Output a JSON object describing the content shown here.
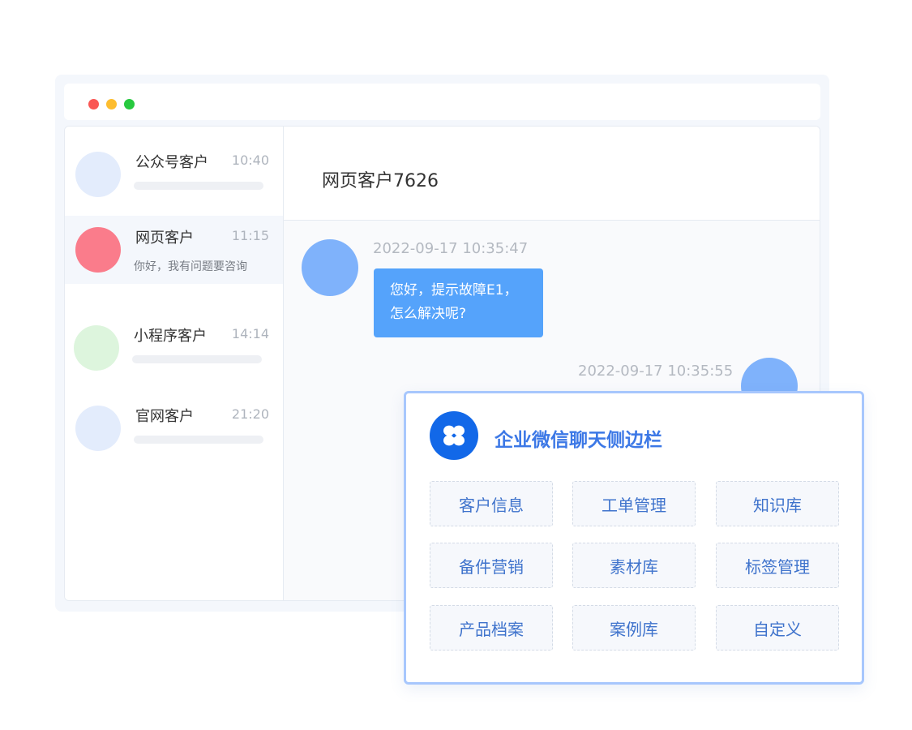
{
  "window_controls": [
    "close",
    "minimize",
    "maximize"
  ],
  "conversations": [
    {
      "name": "公众号客户",
      "time": "10:40",
      "preview": "",
      "avatar_color": "#e3ecfc",
      "active": false
    },
    {
      "name": "网页客户",
      "time": "11:15",
      "preview": "你好，我有问题要咨询",
      "avatar_color": "#fa7c8b",
      "active": true
    },
    {
      "name": "小程序客户",
      "time": "14:14",
      "preview": "",
      "avatar_color": "#ddf5dd",
      "active": false
    },
    {
      "name": "官网客户",
      "time": "21:20",
      "preview": "",
      "avatar_color": "#e3ecfc",
      "active": false
    }
  ],
  "chat": {
    "title": "网页客户7626",
    "messages": [
      {
        "time": "2022-09-17 10:35:47",
        "lines": [
          "您好，提示故障E1，",
          "怎么解决呢?"
        ],
        "side": "left"
      },
      {
        "time": "2022-09-17 10:35:55",
        "lines": [],
        "side": "right"
      }
    ]
  },
  "sidebar_panel": {
    "title": "企业微信聊天侧边栏",
    "logo_icon": "wecom-clover-icon",
    "features": [
      "客户信息",
      "工单管理",
      "知识库",
      "备件营销",
      "素材库",
      "标签管理",
      "产品档案",
      "案例库",
      "自定义"
    ]
  },
  "colors": {
    "accent": "#3c78e6",
    "bubble": "#55a3fb",
    "panel_border": "#a7c7fd",
    "logo_bg": "#1268e8"
  }
}
